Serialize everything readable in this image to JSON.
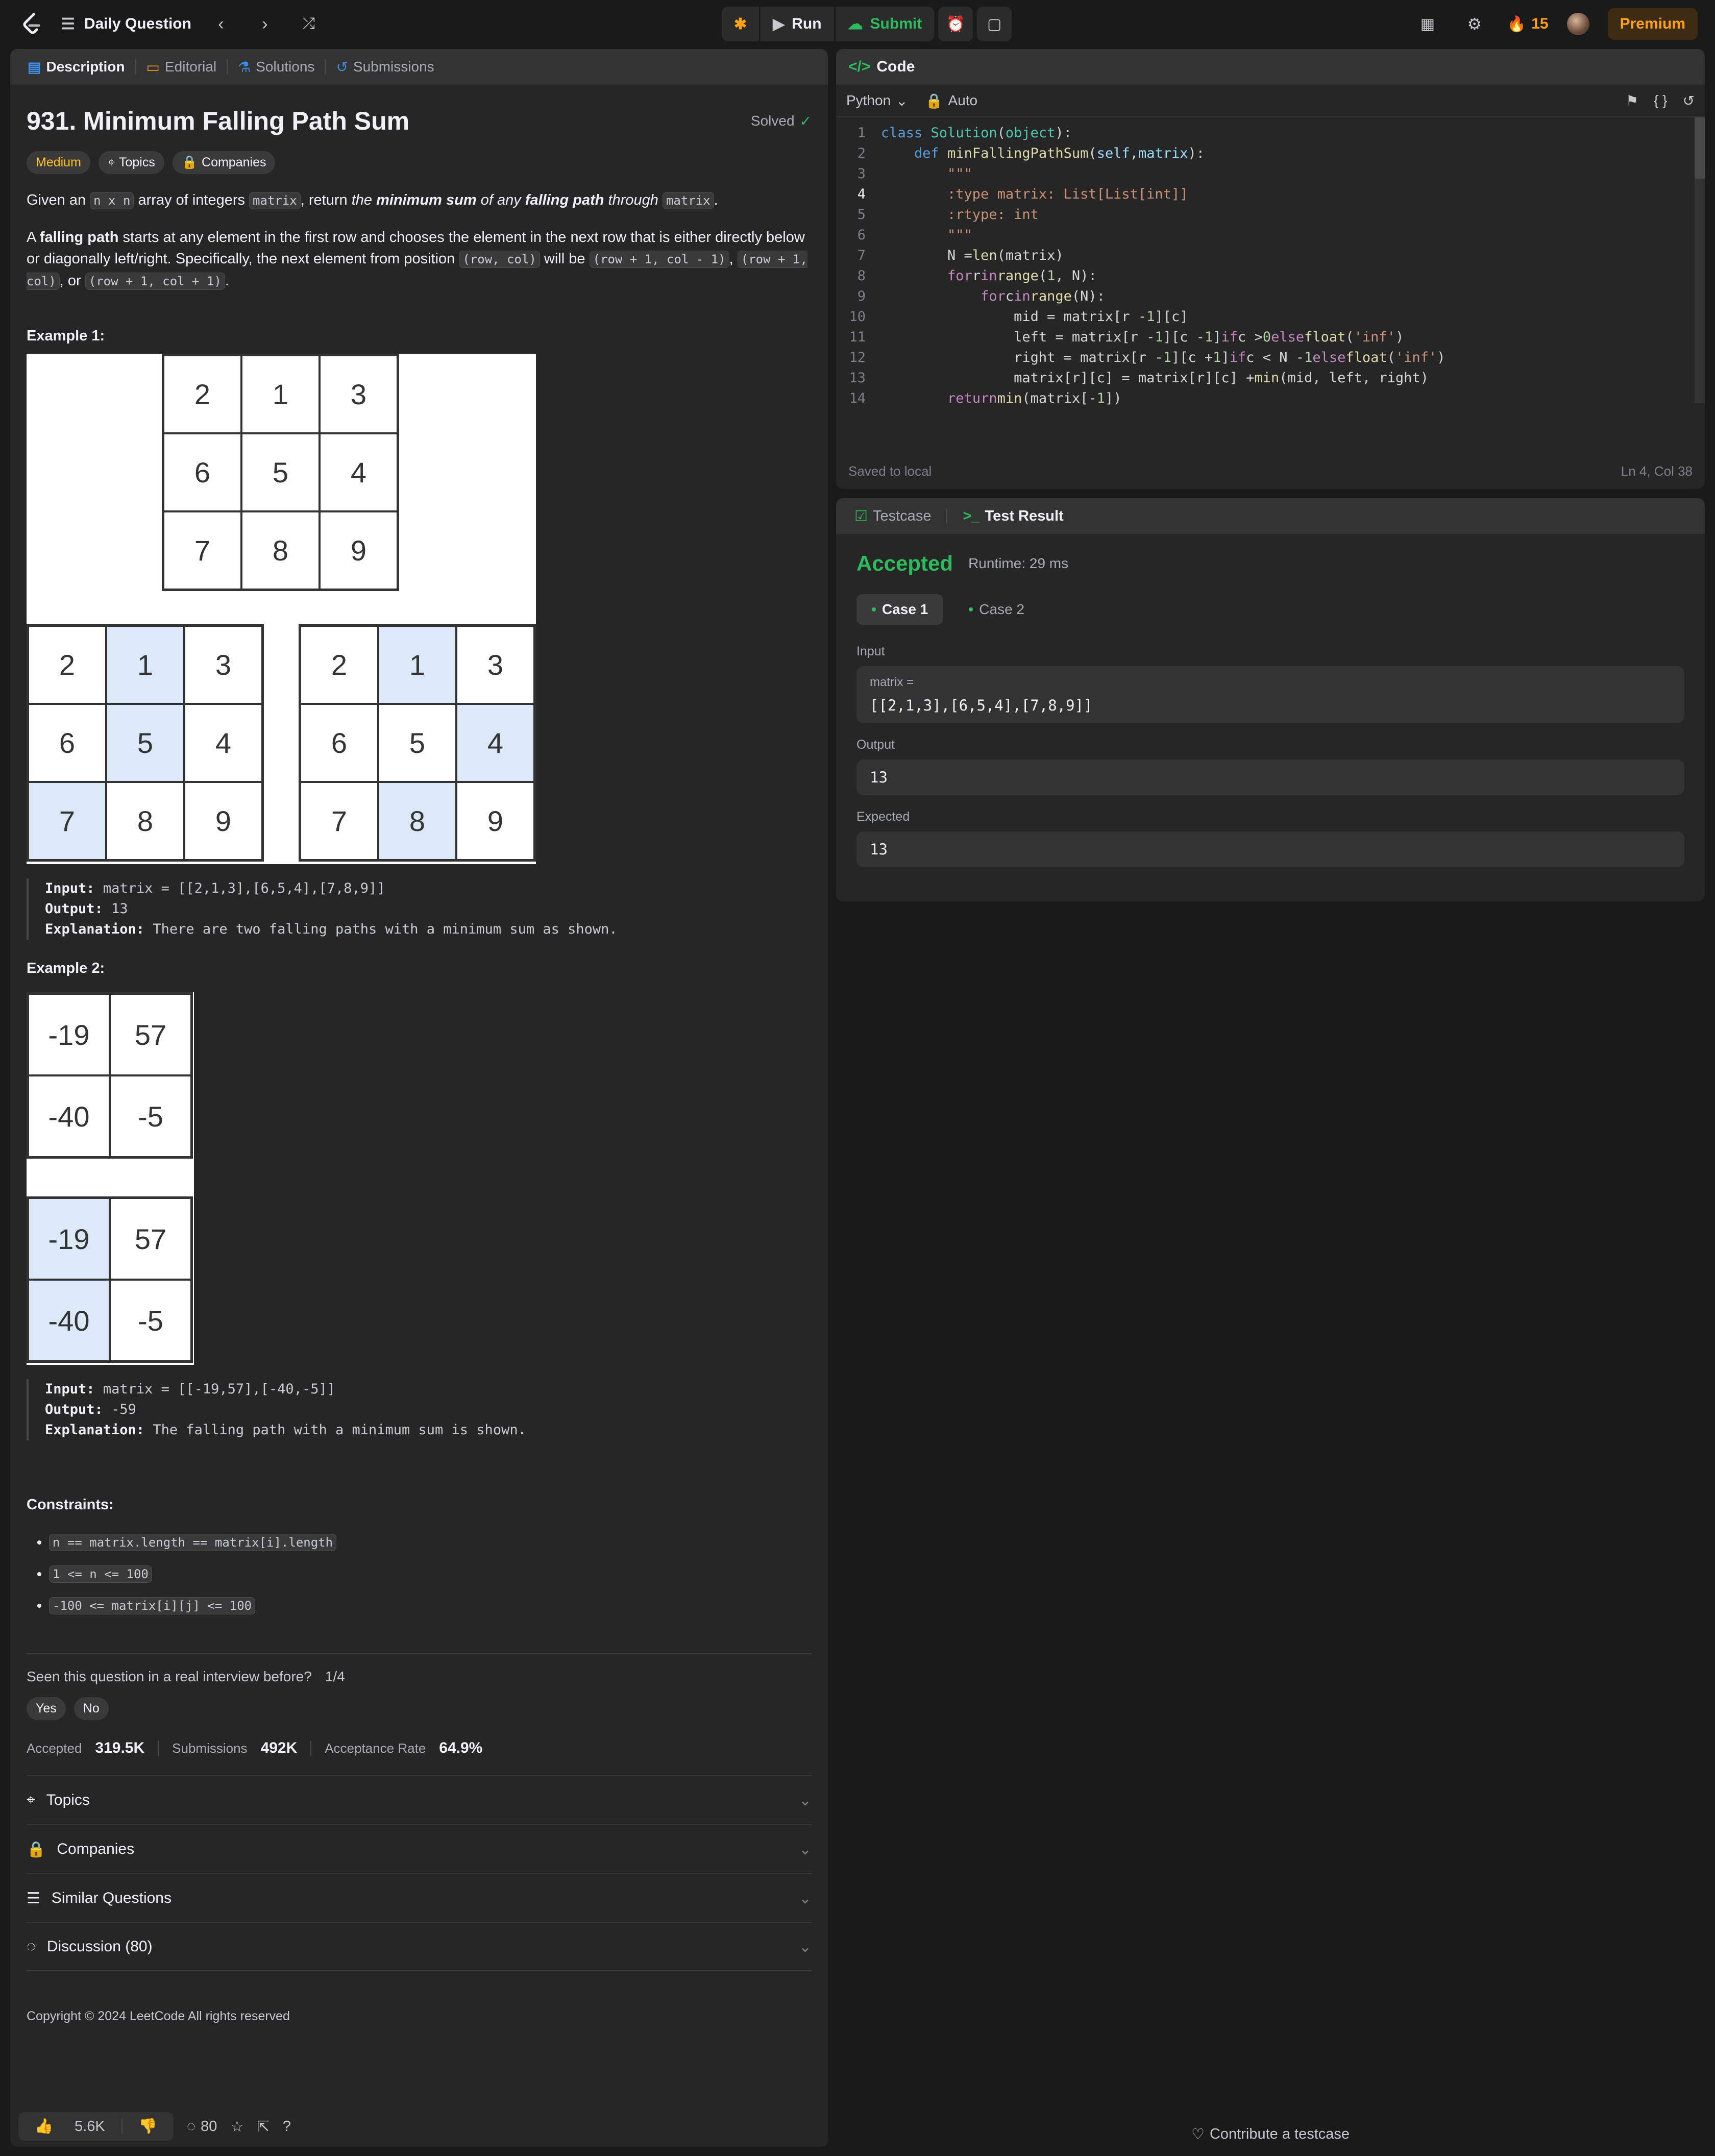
{
  "topbar": {
    "title": "Daily Question",
    "run_label": "Run",
    "submit_label": "Submit",
    "streak": "15",
    "premium_label": "Premium"
  },
  "left": {
    "tabs": [
      "Description",
      "Editorial",
      "Solutions",
      "Submissions"
    ],
    "problem_title": "931. Minimum Falling Path Sum",
    "solved_label": "Solved",
    "chips": [
      "Medium",
      "Topics",
      "Companies"
    ],
    "desc1": {
      "a": "Given an ",
      "code1": "n x n",
      "b": " array of integers ",
      "code2": "matrix",
      "c": ", return ",
      "d": "the ",
      "e": "minimum sum",
      "f": " of any ",
      "g": "falling path",
      "h": " through ",
      "code3": "matrix",
      "i": "."
    },
    "desc2": {
      "a": "A ",
      "b": "falling path",
      "c": " starts at any element in the first row and chooses the element in the next row that is either directly below or diagonally left/right. Specifically, the next element from position ",
      "code1": "(row, col)",
      "d": " will be ",
      "code2": "(row + 1, col - 1)",
      "e": ", ",
      "code3": "(row + 1, col)",
      "f": ", or ",
      "code4": "(row + 1, col + 1)",
      "g": "."
    },
    "example1": {
      "label": "Example 1:",
      "grid_top": [
        [
          "2",
          "1",
          "3"
        ],
        [
          "6",
          "5",
          "4"
        ],
        [
          "7",
          "8",
          "9"
        ]
      ],
      "input_label": "Input:",
      "input": "matrix = [[2,1,3],[6,5,4],[7,8,9]]",
      "output_label": "Output:",
      "output": "13",
      "expl_label": "Explanation:",
      "explanation": "There are two falling paths with a minimum sum as shown."
    },
    "example2": {
      "label": "Example 2:",
      "grid": [
        [
          "-19",
          "57"
        ],
        [
          "-40",
          "-5"
        ]
      ],
      "input_label": "Input:",
      "input": "matrix = [[-19,57],[-40,-5]]",
      "output_label": "Output:",
      "output": "-59",
      "expl_label": "Explanation:",
      "explanation": "The falling path with a minimum sum is shown."
    },
    "constraints_label": "Constraints:",
    "constraints": [
      "n == matrix.length == matrix[i].length",
      "1 <= n <= 100",
      "-100 <= matrix[i][j] <= 100"
    ],
    "interview_q": "Seen this question in a real interview before?",
    "interview_count": "1/4",
    "yes_label": "Yes",
    "no_label": "No",
    "stats": {
      "accepted_label": "Accepted",
      "accepted": "319.5K",
      "submissions_label": "Submissions",
      "submissions": "492K",
      "rate_label": "Acceptance Rate",
      "rate": "64.9%"
    },
    "accordions": [
      "Topics",
      "Companies",
      "Similar Questions",
      "Discussion (80)"
    ],
    "copyright": "Copyright © 2024 LeetCode All rights reserved",
    "likes": "5.6K",
    "comments": "80"
  },
  "code": {
    "header": "Code",
    "language": "Python",
    "mode": "Auto",
    "saved": "Saved to local",
    "cursor": "Ln 4, Col 38"
  },
  "result": {
    "tab_testcase": "Testcase",
    "tab_result": "Test Result",
    "status": "Accepted",
    "runtime": "Runtime: 29 ms",
    "cases": [
      "Case 1",
      "Case 2"
    ],
    "input_label": "Input",
    "input_var": "matrix =",
    "input_value": "[[2,1,3],[6,5,4],[7,8,9]]",
    "output_label": "Output",
    "output_value": "13",
    "expected_label": "Expected",
    "expected_value": "13",
    "contribute": "Contribute a testcase"
  }
}
